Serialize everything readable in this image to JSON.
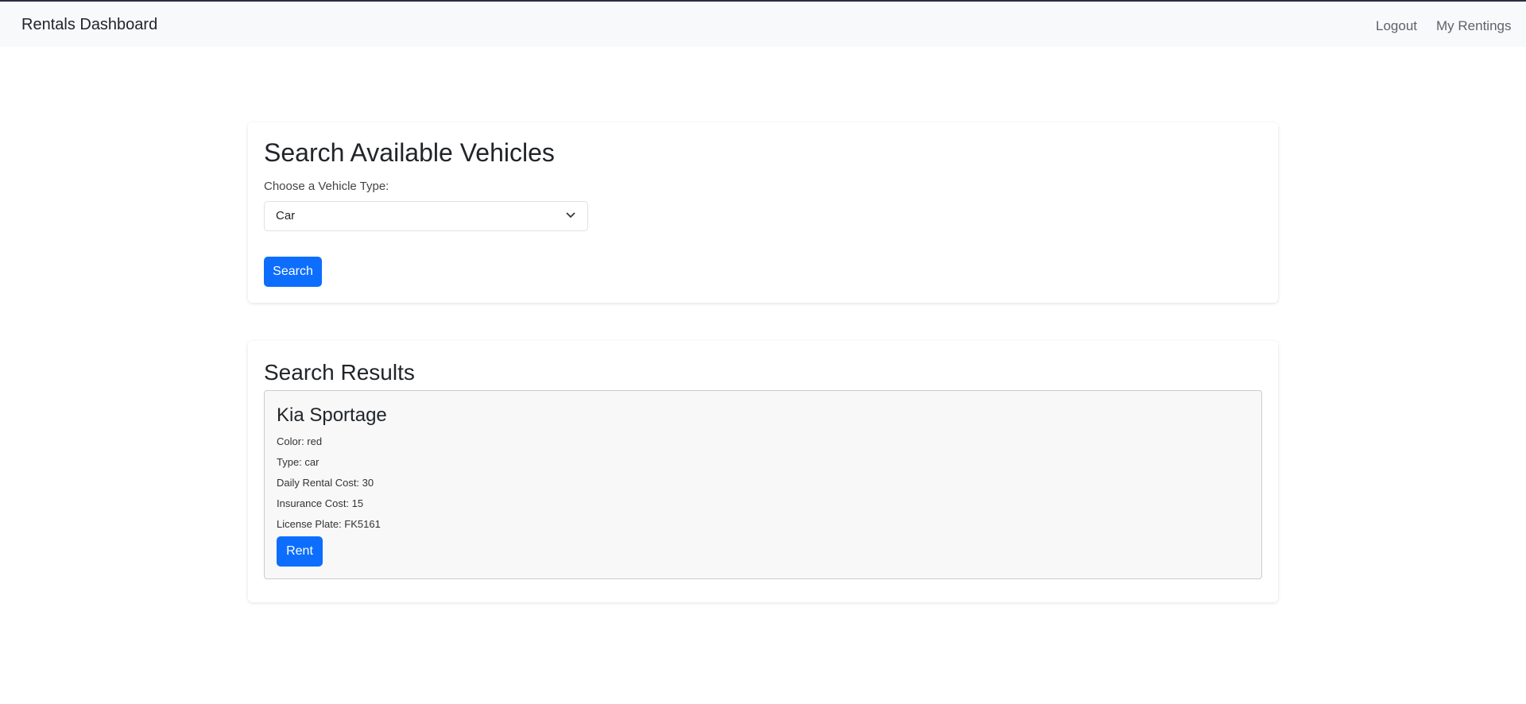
{
  "navbar": {
    "brand": "Rentals Dashboard",
    "links": [
      {
        "label": "Logout"
      },
      {
        "label": "My Rentings"
      }
    ]
  },
  "search": {
    "title": "Search Available Vehicles",
    "vehicle_type_label": "Choose a Vehicle Type:",
    "vehicle_type_value": "Car",
    "search_button": "Search"
  },
  "results": {
    "title": "Search Results",
    "items": [
      {
        "name": "Kia Sportage",
        "color": "Color: red",
        "type": "Type: car",
        "daily_cost": "Daily Rental Cost: 30",
        "insurance_cost": "Insurance Cost: 15",
        "license_plate": "License Plate: FK5161",
        "rent_button": "Rent"
      }
    ]
  },
  "colors": {
    "primary": "#0d6efd",
    "navbar_bg": "#f8f9fa"
  }
}
